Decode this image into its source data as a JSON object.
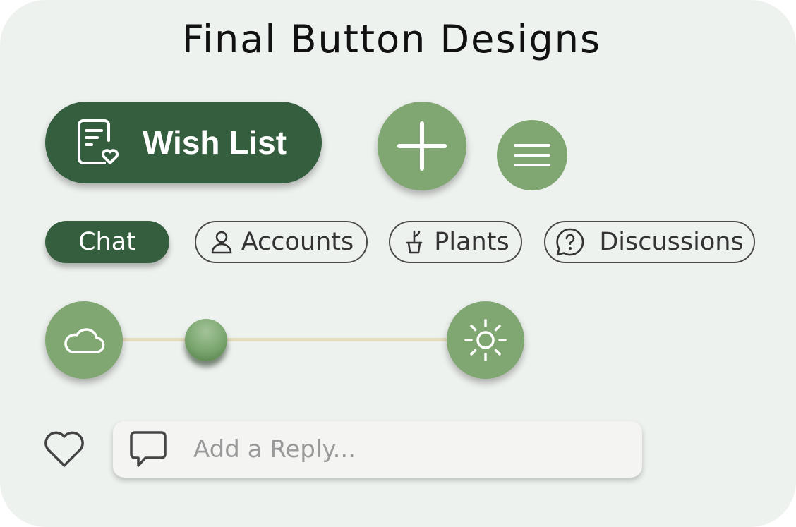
{
  "title": "Final Button Designs",
  "wish_list": {
    "label": "Wish List",
    "icon": "wishlist-heart-document-icon"
  },
  "add_button": {
    "icon": "plus-icon"
  },
  "menu_button": {
    "icon": "hamburger-menu-icon"
  },
  "chips": {
    "chat": {
      "label": "Chat"
    },
    "accounts": {
      "label": "Accounts",
      "icon": "person-icon"
    },
    "plants": {
      "label": "Plants",
      "icon": "potted-plant-icon"
    },
    "discussions": {
      "label": "Discussions",
      "icon": "question-speech-bubble-icon"
    }
  },
  "slider": {
    "min_icon": "cloud-icon",
    "max_icon": "sun-icon",
    "value_fraction": 0.27
  },
  "reply": {
    "placeholder": "Add a Reply...",
    "value": "",
    "icon": "chat-bubble-icon"
  },
  "like_button": {
    "icon": "heart-outline-icon"
  },
  "colors": {
    "card_bg": "#eef2ef",
    "dark_green": "#355e3f",
    "light_green": "#80a772",
    "track": "#e6dcc0"
  }
}
